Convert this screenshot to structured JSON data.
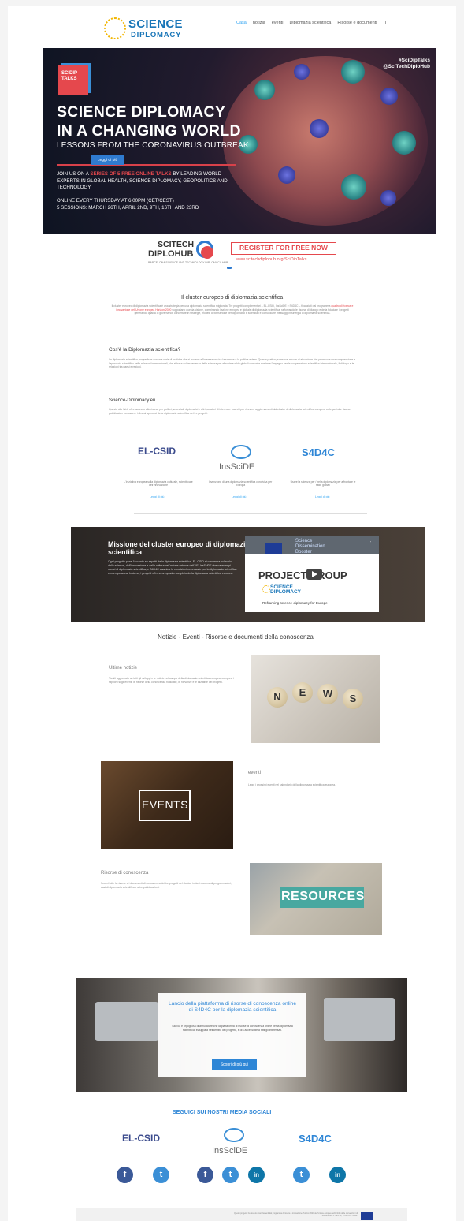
{
  "header": {
    "logo_line1": "SCIENCE",
    "logo_line2": "DIPLOMACY",
    "nav": [
      "Casa",
      "notizia",
      "eventi",
      "Diplomazia scientifica",
      "Risorse e documenti",
      "IT"
    ]
  },
  "hero": {
    "badge": "SCIDIP TALKS",
    "title_line1": "SCIENCE DIPLOMACY",
    "title_line2": "IN A CHANGING WORLD",
    "subtitle": "LESSONS FROM THE CORONAVIRUS OUTBREAK",
    "button": "Leggi di più",
    "join_pre": "JOIN US ON A",
    "join_highlight": "SERIES OF 5 FREE ONLINE TALKS",
    "join_post": "BY LEADING WORLD EXPERTS IN GLOBAL HEALTH, SCIENCE DIPLOMACY, GEOPOLITICS AND TECHNOLOGY.",
    "online_line1": "ONLINE EVERY THURSDAY AT 6.00PM (CET/CEST)",
    "online_line2": "5 SESSIONS: MARCH 26TH, APRIL 2ND, 9TH, 16TH AND 23RD",
    "hashtag1": "#SciDipTalks",
    "hashtag2": "@SciTechDiploHub"
  },
  "scitech": {
    "line1": "SCITECH",
    "line2": "DIPLOHUB",
    "tagline": "BARCELONA SCIENCE AND TECHNOLOGY DIPLOMACY HUB",
    "register": "REGISTER FOR FREE NOW",
    "url": "www.scitechdiplohub.org/SciDipTalks"
  },
  "cluster": {
    "title": "Il cluster europeo di diplomazia scientifica",
    "text_pre": "Il cluster europeo di diplomazia scientifica è una strategia per una diplomazia scientifica migliorata. Tre progetti complementari – EL-CSID, InsSciDE e S4D4C – finanziati dal programma ",
    "text_link": "quadro di ricerca e innovazione dell'Unione europea Horizon 2020",
    "text_post": " supportano questa visione, combinando l'azione europea e globale di diplomazia scientifica, rafforzando le risorse di dialogo e della fiducia e i progetti generando qualità di governance concertate in strategie, modelli di formazione per diplomatici e scienziati e comunicare messaggi in sinergia di diplomazia scientifica.",
    "q_title": "Cos'è la Diplomazia scientifica?",
    "q_text": "La diplomazia scientifica progredisce con una serie di pratiche che si trovano all'intersezione tra la scienza e la politica estera. Questa pratica promuove misure di attuazione che promuove una comprensione e l'approccio scientifico nelle relazioni internazionali, che si basa sull'esperienza della scienza per affrontare sfide globali comuni e sostiene l'impegno per la cooperazione scientifica internazionale, il dialogo e le relazioni tra paesi e regioni.",
    "eu_title": "Science-Diplomacy.eu",
    "eu_text": "Questo sito Web offre accesso alle risorse per politici, scienziati, diplomatici e altri portatori di interesse. Iscriviti per ricevere aggiornamenti dal cluster di diplomazia scientifica europeo, collegarti alle risorse pubblicate e conoscere i diversi approcci della diplomazia scientifica nei tre progetti."
  },
  "partners": [
    {
      "name": "EL-CSID",
      "desc": "L'iniziativa europea sulla diplomazia culturale, scientifica e dell'innovazione",
      "link": "Leggi di più"
    },
    {
      "name": "InsSciDE",
      "desc": "Invenzione di una diplomazia scientifica condivisa per l'Europa",
      "link": "Leggi di più"
    },
    {
      "name": "S4D4C",
      "desc": "Usare la scienza per / nella diplomazia per affrontare le sfide globali",
      "link": "Leggi di più"
    }
  ],
  "mission": {
    "title": "Missione del cluster europeo di diplomazia scientifica",
    "text": "Ogni progetto pone l'accento su aspetti della diplomazia scientifica. EL-CSID si concentra sul ruolo della scienza, dell'innovazione e della cultura nell'azione esterna dell'UE; InsSciDE ricerca esempi storici di diplomazia scientifica; e S4D4C esamina le condizioni necessarie per la diplomazia scientifica contemporanea. Insieme, i progetti offrono un quadro completo della diplomazia scientifica europea.",
    "video_line1": "Science",
    "video_line2": "Dissemination",
    "video_line3": "Booster",
    "video_project": "PROJECT GROUP",
    "video_sd1": "SCIENCE",
    "video_sd2": "DIPLOMACY",
    "video_caption": "Reframing science diplomacy for Europe"
  },
  "knowledge": {
    "heading": "Notizie - Eventi - Risorse e documenti della conoscenza",
    "news_title": "Ultime notizie",
    "news_text": "Tieniti aggiornato su tutti gli sviluppi e le notizie nel campo della diplomazia scientifica europea, compresi i rapporti sugli eventi, le risorse della conoscenza rilasciate, le rilevanze e le iniziative dei progetti.",
    "news_tiles": [
      "N",
      "E",
      "W",
      "S"
    ],
    "events_title": "eventi",
    "events_text": "Leggi i prossimi eventi nel calendario della diplomazia scientifica europea.",
    "events_img": "EVENTS",
    "res_title": "Risorse di conoscenza",
    "res_text": "Scopri tutte le risorse e i documenti di conoscenza dei tre progetti del cluster, inclusi documenti programmatici, casi di diplomazia scientifica e altre pubblicazioni.",
    "res_img": "RESOURCES"
  },
  "platform": {
    "title": "Lancio della piattaforma di risorse di conoscenza online di S4D4C per la diplomazia scientifica",
    "text": "S4D4C è orgogliosa di annunciare che la piattaforma di risorse di conoscenza online per la diplomazia scientifica, sviluppata nell'ambito del progetto, è ora accessibile a tutti gli interessati.",
    "button": "Scopri di più qui"
  },
  "social": {
    "title": "SEGUICI SUI NOSTRI MEDIA SOCIALI",
    "logos": [
      "EL-CSID",
      "InsSciDE",
      "S4D4C"
    ]
  },
  "footer": {
    "text": "Questo progetto ha ricevuto finanziamenti dal programma di ricerca e innovazione Horizon 2020 dell'Unione europea nell'ambito delle convenzioni di sovvenzione n. 693799, 770523 e 770342."
  },
  "colors": {
    "accent": "#2ea3f2",
    "brand_blue": "#1976b8",
    "red": "#e5484d"
  }
}
